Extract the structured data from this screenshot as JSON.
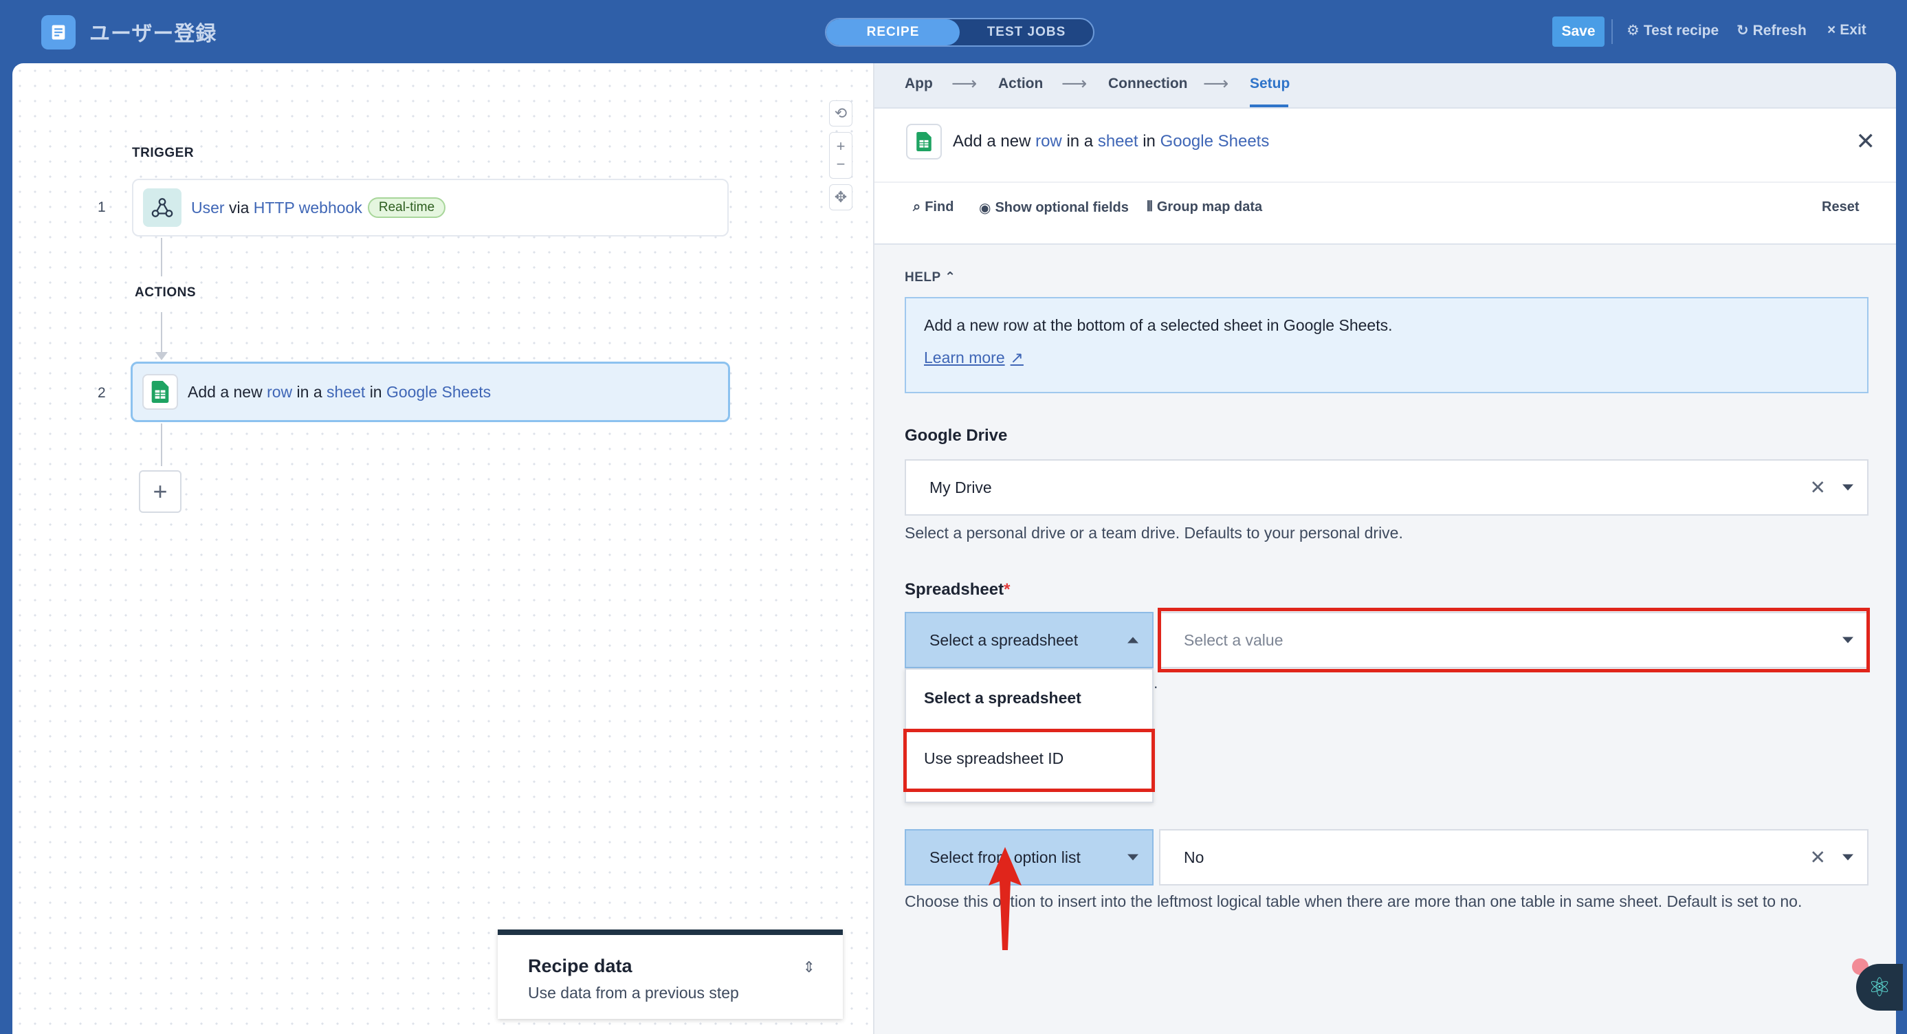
{
  "header": {
    "title": "ユーザー登録",
    "tabs": [
      "RECIPE",
      "TEST JOBS"
    ],
    "save": "Save",
    "test_recipe": "Test recipe",
    "refresh": "Refresh",
    "exit": "Exit"
  },
  "canvas": {
    "trigger_label": "TRIGGER",
    "actions_label": "ACTIONS",
    "step1": {
      "num": "1",
      "a": "User",
      "b": "via",
      "c": "HTTP webhook",
      "badge": "Real-time"
    },
    "step2": {
      "num": "2",
      "a": "Add a new",
      "b": "row",
      "c": "in a",
      "d": "sheet",
      "e": "in",
      "f": "Google Sheets"
    },
    "add_step": "+",
    "recipe_data": {
      "title": "Recipe data",
      "subtitle": "Use data from a previous step"
    }
  },
  "panel": {
    "breadcrumbs": [
      "App",
      "Action",
      "Connection",
      "Setup"
    ],
    "active_breadcrumb": "Setup",
    "title": {
      "a": "Add a new",
      "b": "row",
      "c": "in a",
      "d": "sheet",
      "e": "in",
      "f": "Google Sheets"
    },
    "tools": {
      "find": "Find",
      "optional": "Show optional fields",
      "group": "Group map data",
      "reset": "Reset"
    },
    "help": {
      "label": "HELP",
      "text": "Add a new row at the bottom of a selected sheet in Google Sheets.",
      "learn_more": "Learn more"
    },
    "google_drive": {
      "label": "Google Drive",
      "value": "My Drive",
      "hint": "Select a personal drive or a team drive. Defaults to your personal drive."
    },
    "spreadsheet": {
      "label": "Spreadsheet",
      "required": "*",
      "mode": "Select a spreadsheet",
      "placeholder": "Select a value",
      "options": [
        "Select a spreadsheet",
        "Use spreadsheet ID"
      ],
      "partial_hint": "."
    },
    "leftmost": {
      "mode": "Select from option list",
      "value": "No",
      "hint": "Choose this option to insert into the leftmost logical table when there are more than one table in same sheet. Default is set to no."
    }
  },
  "colors": {
    "topbar": "#2f5fa8",
    "accent": "#2f74c9",
    "highlight": "#e0251b",
    "link": "#3f66b6"
  }
}
